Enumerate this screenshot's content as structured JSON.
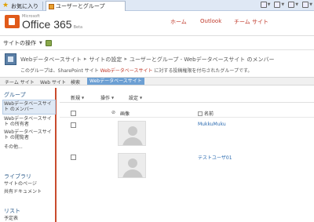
{
  "browser": {
    "favorites_label": "お気に入り",
    "tab_title": "ユーザーとグループ"
  },
  "o365": {
    "brand_small": "Microsoft",
    "brand": "Office 365",
    "beta": "Beta",
    "nav": {
      "home": "ホーム",
      "outlook": "Outlook",
      "team_site": "チーム サイト"
    }
  },
  "site_actions": {
    "label": "サイトの操作"
  },
  "breadcrumb": {
    "items": [
      "Webデータベースサイト",
      "サイトの設定",
      "ユーザーとグループ - Webデータベースサイト のメンバー"
    ],
    "separator": "▸"
  },
  "description": {
    "prefix": "このグループは、SharePoint サイト ",
    "site": "Webデータベースサイト",
    "suffix": " に対する投稿権限を付与されたグループです。"
  },
  "linkbar": {
    "items": [
      "チーム サイト",
      "Web サイト",
      "検索",
      "Webデータベースサイト"
    ]
  },
  "leftnav": {
    "groups_heading": "グループ",
    "groups": [
      "Webデータベースサイト のメンバー",
      "Webデータベースサイト の所有者",
      "Webデータベースサイト の閲覧者",
      "その他..."
    ],
    "libraries_heading": "ライブラリ",
    "libraries": [
      "サイトのページ",
      "共有ドキュメント"
    ],
    "lists_heading": "リスト",
    "lists": [
      "予定表"
    ]
  },
  "toolbar": {
    "new": "新規",
    "actions": "操作",
    "settings": "設定"
  },
  "list": {
    "columns": {
      "picture": "画像",
      "name": "名前"
    },
    "rows": [
      {
        "name": "MukkuMuku"
      },
      {
        "name": "テストユーザ01"
      }
    ]
  },
  "colors": {
    "accent": "#c0392b",
    "selected_tab": "#6c9fd3",
    "link": "#2a6ab0"
  }
}
